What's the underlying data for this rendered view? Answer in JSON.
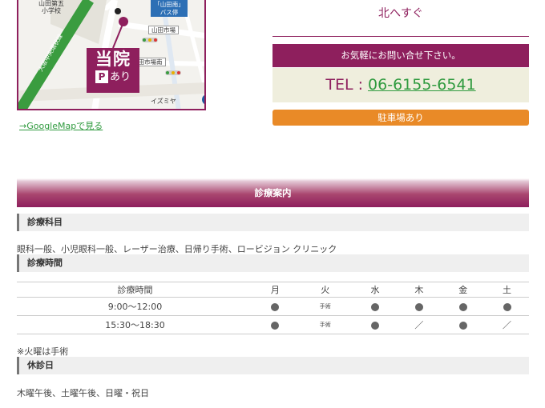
{
  "map": {
    "school_label": "山田第五\n小学校",
    "busstop_label": "「山田南」\nバス停",
    "market_label": "山田市場",
    "market_south_label": "山田市場南",
    "clinic_logo_big": "当院",
    "clinic_logo_parking_icon": "P",
    "clinic_logo_parking_text": "あり",
    "road_label": "大阪中央環状線",
    "izumiya_label": "イズミヤ",
    "route_number": "1"
  },
  "links": {
    "google_map": "→GoogleMapで見る"
  },
  "access": {
    "direction": "北へすぐ",
    "contact_heading": "お気軽にお問い合せ下さい。",
    "tel_prefix": "TEL : ",
    "tel_number": "06-6155-6541",
    "parking_button": "駐車場あり"
  },
  "info": {
    "section_title": "診療案内",
    "departments_heading": "診療科目",
    "departments_text": "眼科一般、小児眼科一般、レーザー治療、日帰り手術、ロービジョン クリニック",
    "hours_heading": "診療時間",
    "table": {
      "header_label": "診療時間",
      "days": [
        "月",
        "火",
        "水",
        "木",
        "金",
        "土"
      ],
      "rows": [
        {
          "time": "9:00〜12:00",
          "cells": [
            "●",
            "手術",
            "●",
            "●",
            "●",
            "●"
          ]
        },
        {
          "time": "15:30〜18:30",
          "cells": [
            "●",
            "手術",
            "●",
            "／",
            "●",
            "／"
          ]
        }
      ]
    },
    "tuesday_note": "※火曜は手術",
    "closed_heading": "休診日",
    "closed_text": "木曜午後、土曜午後、日曜・祝日"
  }
}
